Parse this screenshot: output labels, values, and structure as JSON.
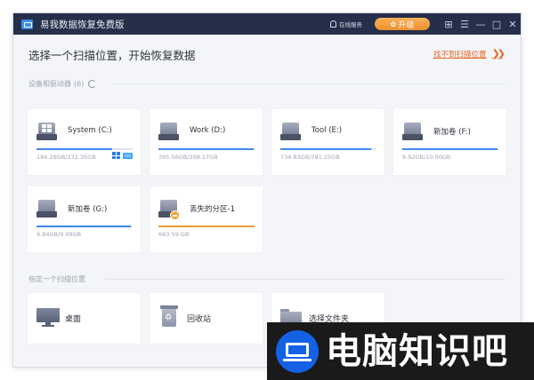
{
  "window": {
    "title": "易我数据恢复免费版",
    "online_service": "在线服务",
    "upgrade_label": "升级"
  },
  "headline": "选择一个扫描位置，开始恢复数据",
  "cant_find_link": "找不到扫描位置",
  "devices_section": {
    "label": "设备和驱动器",
    "count": "(6)"
  },
  "drives": [
    {
      "name": "System (C:)",
      "size": "184.29GB/232.35GB",
      "used_fraction": 0.79,
      "bar_color": "#3f88e8",
      "system": true
    },
    {
      "name": "Work (D:)",
      "size": "395.56GB/398.17GB",
      "used_fraction": 0.99,
      "bar_color": "#3f88e8"
    },
    {
      "name": "Tool (E:)",
      "size": "734.83GB/781.25GB",
      "used_fraction": 0.94,
      "bar_color": "#3f88e8"
    },
    {
      "name": "新加卷 (F:)",
      "size": "9.92GB/10.00GB",
      "used_fraction": 0.99,
      "bar_color": "#3f88e8"
    },
    {
      "name": "新加卷 (G:)",
      "size": "9.84GB/9.99GB",
      "used_fraction": 0.98,
      "bar_color": "#3f88e8"
    },
    {
      "name": "丢失的分区-1",
      "size": "663.59 GB",
      "used_fraction": 1.0,
      "bar_color": "#f09a3b",
      "lost": true
    }
  ],
  "system_badge_label": "SSD",
  "location_section": {
    "label": "指定一个扫描位置"
  },
  "locations": [
    {
      "name": "桌面",
      "icon": "desktop-icon"
    },
    {
      "name": "回收站",
      "icon": "recycle-bin-icon"
    },
    {
      "name": "选择文件夹",
      "icon": "folder-icon"
    }
  ],
  "watermark": {
    "text": "电脑知识吧"
  }
}
